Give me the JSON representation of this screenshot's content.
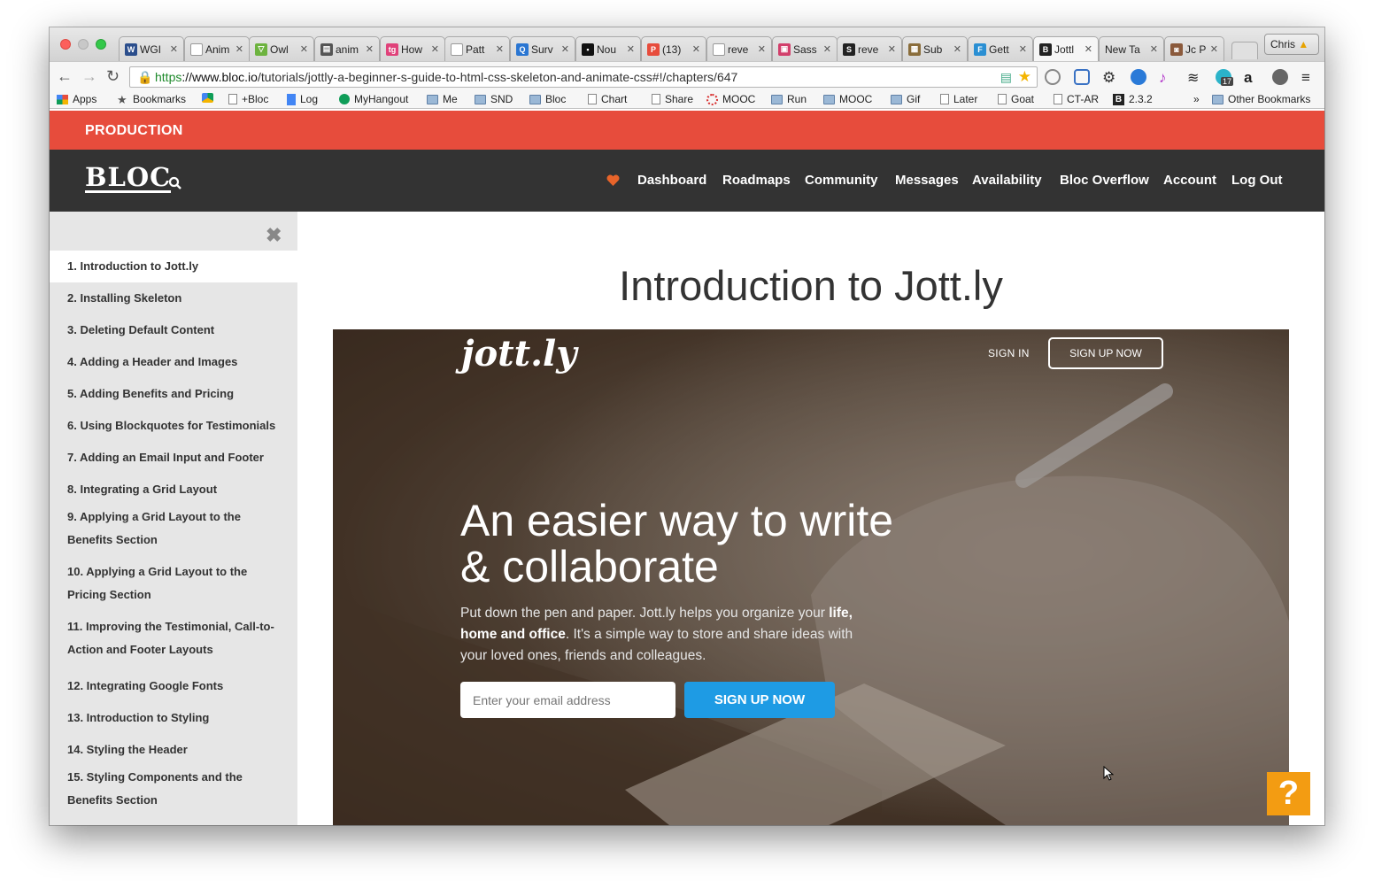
{
  "browser": {
    "tabs": [
      {
        "label": "WGI",
        "fav_color": "#2b4e8c",
        "fav_glyph": "W"
      },
      {
        "label": "Anim",
        "fav_color": "#ffffff",
        "fav_glyph": ""
      },
      {
        "label": "Owl",
        "fav_color": "#6db33f",
        "fav_glyph": "▽"
      },
      {
        "label": "anim",
        "fav_color": "#555555",
        "fav_glyph": "▤"
      },
      {
        "label": "How",
        "fav_color": "#e0427a",
        "fav_glyph": "tg"
      },
      {
        "label": "Patt",
        "fav_color": "#ffffff",
        "fav_glyph": ""
      },
      {
        "label": "Surv",
        "fav_color": "#2a76d2",
        "fav_glyph": "Q"
      },
      {
        "label": "Nou",
        "fav_color": "#111111",
        "fav_glyph": "▪"
      },
      {
        "label": "(13)",
        "fav_color": "#e74c3c",
        "fav_glyph": "P"
      },
      {
        "label": "reve",
        "fav_color": "#ffffff",
        "fav_glyph": ""
      },
      {
        "label": "Sass",
        "fav_color": "#d23f6b",
        "fav_glyph": "▣"
      },
      {
        "label": "reve",
        "fav_color": "#222222",
        "fav_glyph": "S"
      },
      {
        "label": "Sub",
        "fav_color": "#8a6d3b",
        "fav_glyph": "▦"
      },
      {
        "label": "Gett",
        "fav_color": "#2a8fd3",
        "fav_glyph": "F"
      },
      {
        "label": "Jottl",
        "fav_color": "#222222",
        "fav_glyph": "B"
      },
      {
        "label": "New Ta",
        "fav_color": "",
        "fav_glyph": ""
      },
      {
        "label": "Jc P",
        "fav_color": "#8b5a3c",
        "fav_glyph": "◙"
      }
    ],
    "user": "Chris",
    "url_https": "https",
    "url_domain": "://www.bloc.io",
    "url_path": "/tutorials/jottly-a-beginner-s-guide-to-html-css-skeleton-and-animate-css#!/chapters/647",
    "ext_badge": "17",
    "bookmarks": [
      {
        "label": "Apps",
        "type": "apps"
      },
      {
        "label": "Bookmarks",
        "type": "star"
      },
      {
        "label": "",
        "type": "drive"
      },
      {
        "label": "+Bloc",
        "type": "page"
      },
      {
        "label": "Log",
        "type": "doc"
      },
      {
        "label": "MyHangout",
        "type": "hangout"
      },
      {
        "label": "Me",
        "type": "folder"
      },
      {
        "label": "SND",
        "type": "folder"
      },
      {
        "label": "Bloc",
        "type": "folder"
      },
      {
        "label": "Chart",
        "type": "page"
      },
      {
        "label": "Share",
        "type": "page"
      },
      {
        "label": "MOOC",
        "type": "ring"
      },
      {
        "label": "Run",
        "type": "folder"
      },
      {
        "label": "MOOC",
        "type": "folder"
      },
      {
        "label": "Gif",
        "type": "folder"
      },
      {
        "label": "Later",
        "type": "page"
      },
      {
        "label": "Goat",
        "type": "page"
      },
      {
        "label": "CT-AR",
        "type": "page"
      },
      {
        "label": "2.3.2",
        "type": "bloc"
      }
    ],
    "bookmarks_more": "»",
    "other_bookmarks": "Other Bookmarks"
  },
  "banner": {
    "label": "PRODUCTION",
    "color": "#e74c3c"
  },
  "nav": {
    "logo": "BLOC",
    "links": [
      "Dashboard",
      "Roadmaps",
      "Community",
      "Messages",
      "Availability",
      "Bloc Overflow",
      "Account",
      "Log Out"
    ],
    "heart_color": "#e8642a"
  },
  "sidebar": {
    "items": [
      "1. Introduction to Jott.ly",
      "2. Installing Skeleton",
      "3. Deleting Default Content",
      "4. Adding a Header and Images",
      "5. Adding Benefits and Pricing",
      "6. Using Blockquotes for Testimonials",
      "7. Adding an Email Input and Footer",
      "8. Integrating a Grid Layout",
      "9. Applying a Grid Layout to the Benefits Section",
      "10. Applying a Grid Layout to the Pricing Section",
      "11. Improving the Testimonial, Call-to-Action and Footer Layouts",
      "12. Integrating Google Fonts",
      "13. Introduction to Styling",
      "14. Styling the Header",
      "15. Styling Components and the Benefits Section"
    ],
    "active_index": 0
  },
  "page": {
    "title": "Introduction to Jott.ly"
  },
  "hero": {
    "logo": "jott.ly",
    "sign_in": "SIGN IN",
    "sign_up_top": "SIGN UP NOW",
    "headline": "An easier way to write & collaborate",
    "lead_before": "Put down the pen and paper. Jott.ly helps you organize your ",
    "lead_bold": "life, home and office",
    "lead_after": ". It's a simple way to store and share ideas with your loved ones, friends and colleagues.",
    "email_placeholder": "Enter your email address",
    "sign_up_main": "SIGN UP NOW",
    "button_color": "#1e9be4"
  },
  "help": {
    "label": "?",
    "color": "#f39c12"
  }
}
